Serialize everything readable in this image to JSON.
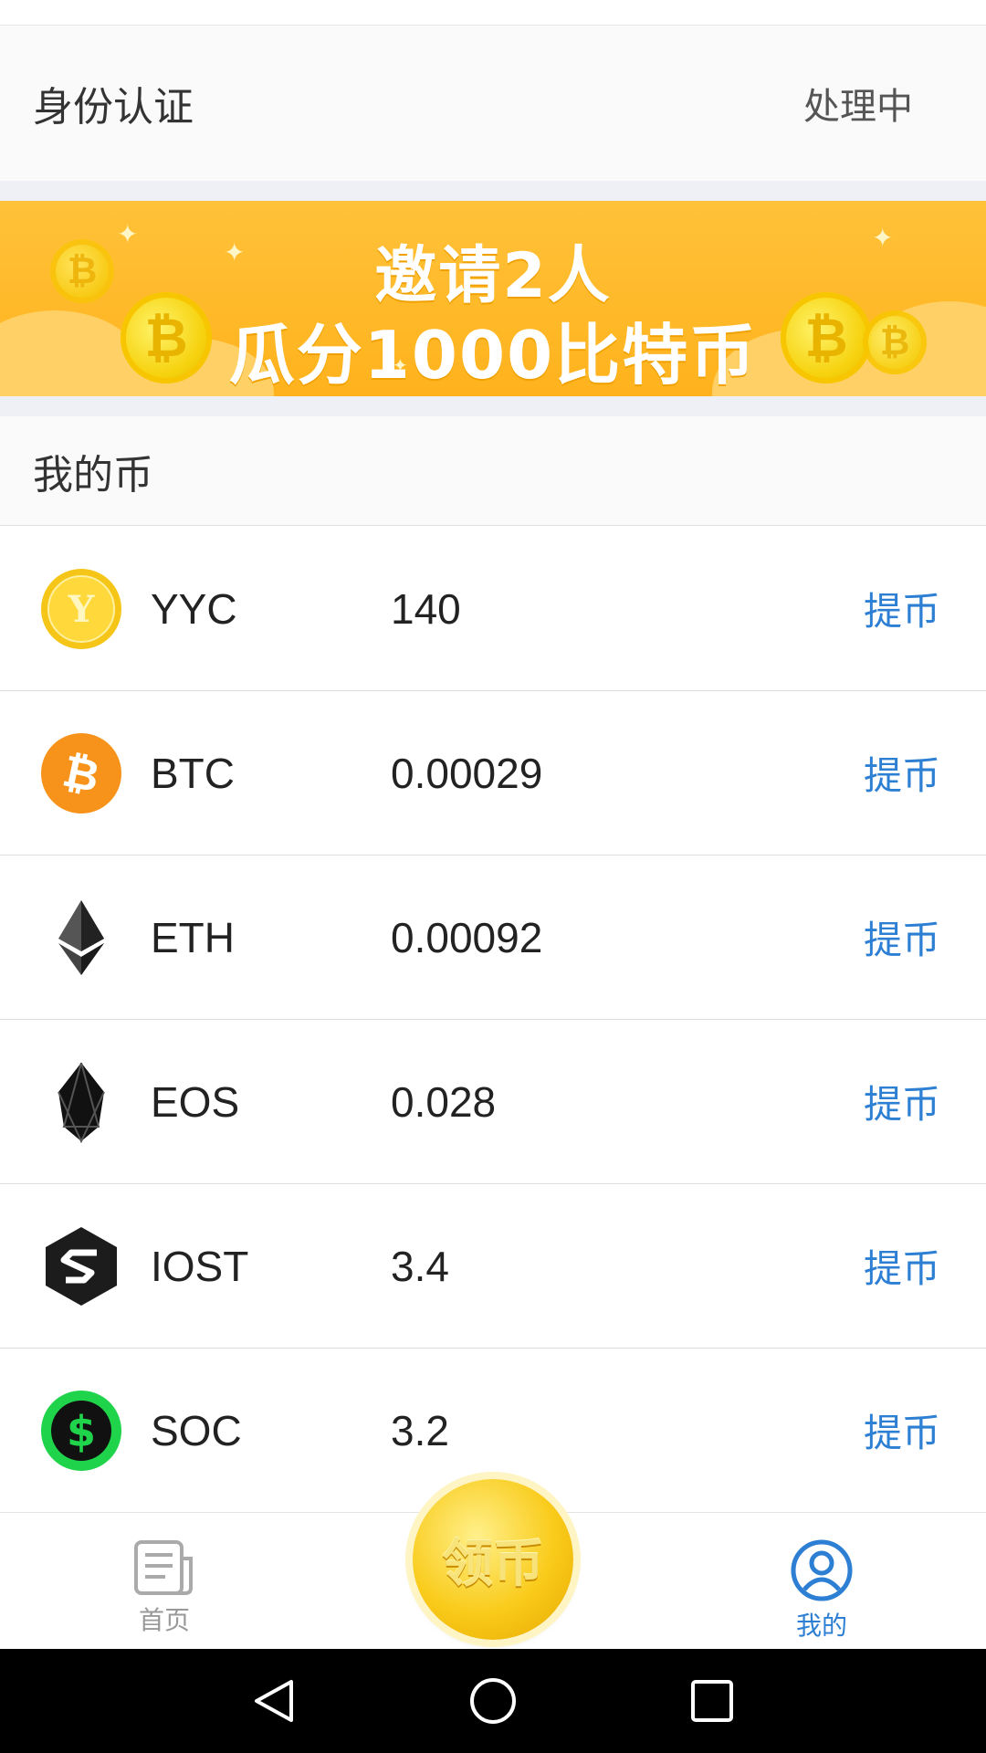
{
  "verification": {
    "title": "身份认证",
    "status": "处理中"
  },
  "banner": {
    "line1": "邀请2人",
    "line2": "瓜分1000比特币"
  },
  "section": {
    "title": "我的币"
  },
  "coins": [
    {
      "symbol": "YYC",
      "amount": "140",
      "action": "提币",
      "icon": "yyc-coin-icon"
    },
    {
      "symbol": "BTC",
      "amount": "0.00029",
      "action": "提币",
      "icon": "btc-coin-icon"
    },
    {
      "symbol": "ETH",
      "amount": "0.00092",
      "action": "提币",
      "icon": "eth-coin-icon"
    },
    {
      "symbol": "EOS",
      "amount": "0.028",
      "action": "提币",
      "icon": "eos-coin-icon"
    },
    {
      "symbol": "IOST",
      "amount": "3.4",
      "action": "提币",
      "icon": "iost-coin-icon"
    },
    {
      "symbol": "SOC",
      "amount": "3.2",
      "action": "提币",
      "icon": "soc-coin-icon"
    }
  ],
  "tabbar": {
    "home_label": "首页",
    "claim_label": "领币",
    "mine_label": "我的"
  },
  "colors": {
    "accent": "#2d7fd3",
    "banner": "#ffb21c",
    "gold": "#f9cb1a"
  }
}
